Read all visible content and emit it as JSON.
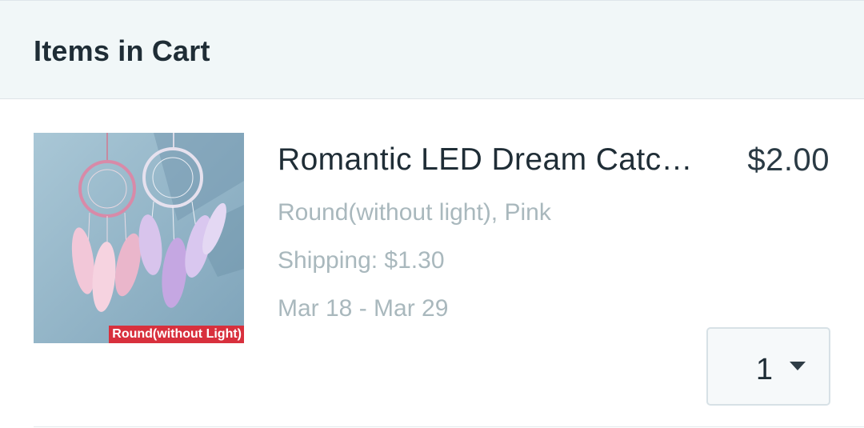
{
  "header": {
    "title": "Items in Cart"
  },
  "cart": {
    "items": [
      {
        "image_caption": "Round(without Light)",
        "title": "Romantic LED Dream Catcher",
        "price": "$2.00",
        "variant": "Round(without light), Pink",
        "shipping": "Shipping: $1.30",
        "delivery": "Mar 18 - Mar 29",
        "quantity": "1"
      }
    ]
  },
  "icons": {
    "quantity_dropdown": "caret-down-icon"
  },
  "colors": {
    "header_bg": "#f1f7f8",
    "text_primary": "#1f2d36",
    "text_muted": "#a9b8bd",
    "caption_red": "#d8303d"
  }
}
